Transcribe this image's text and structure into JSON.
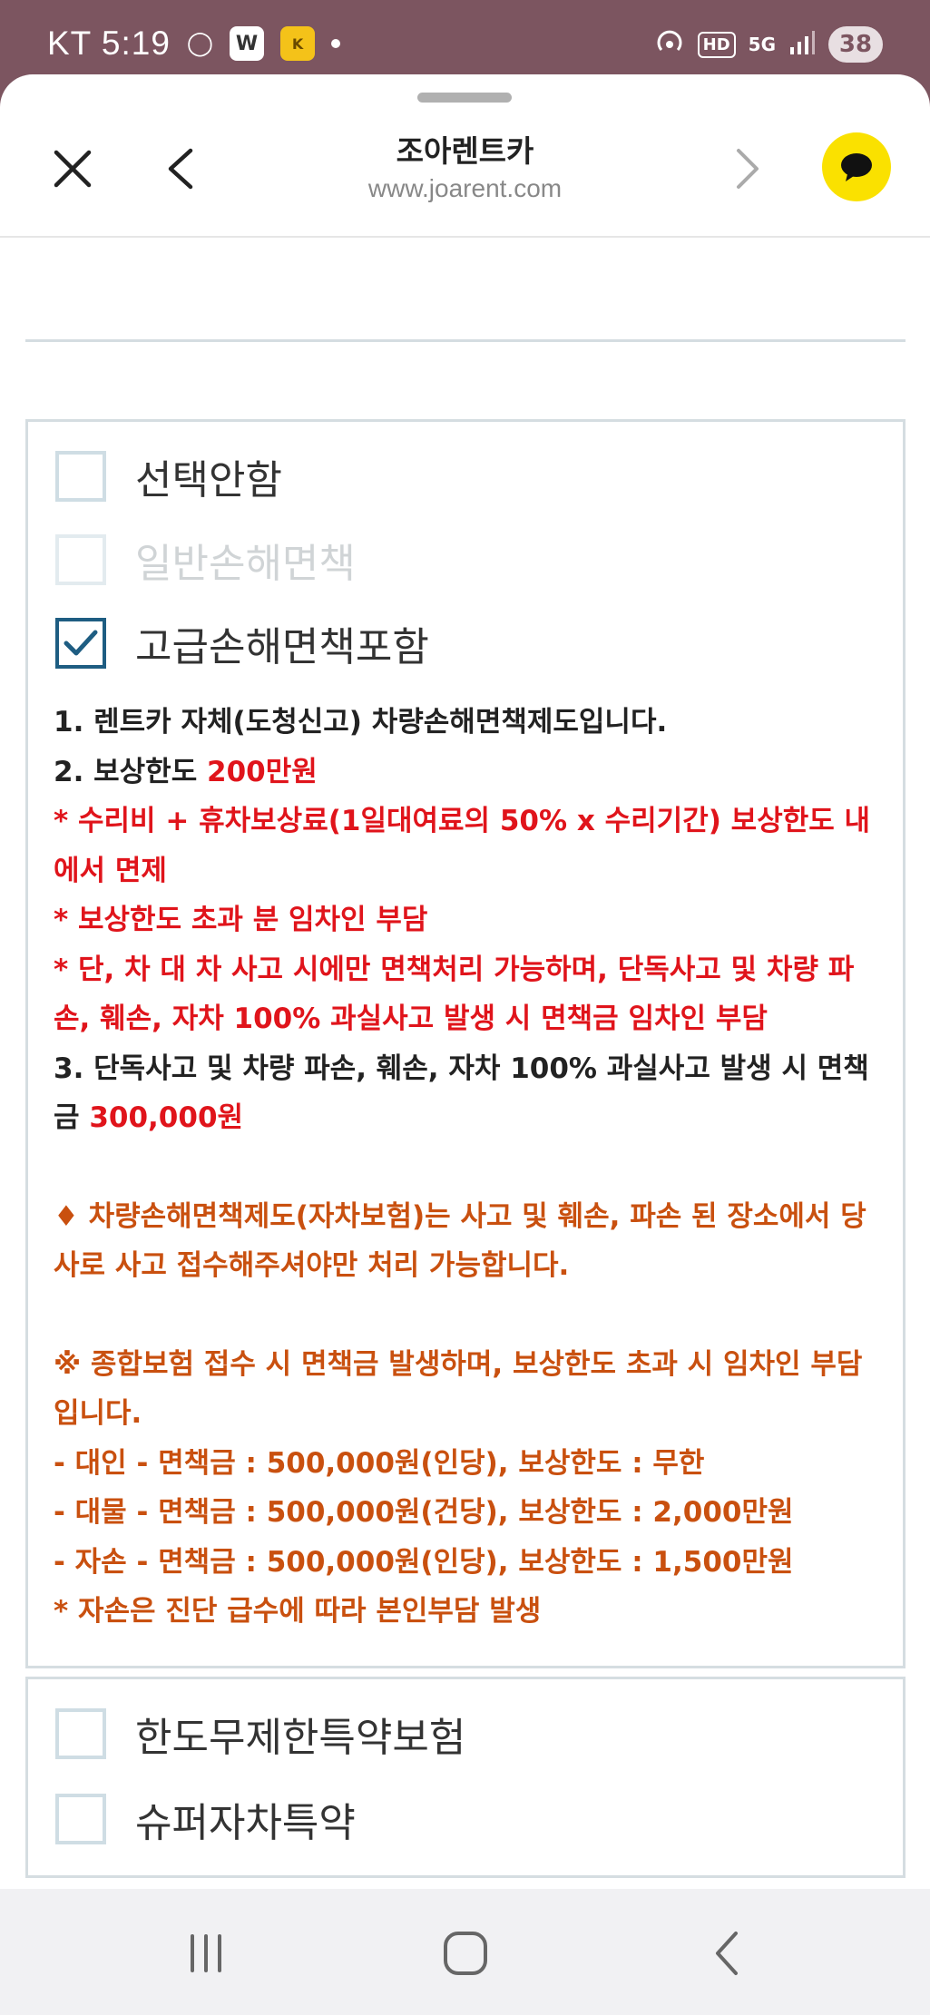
{
  "status_bar": {
    "carrier_time": "KT 5:19",
    "battery": "38",
    "network": "5G",
    "hd": "HD"
  },
  "header": {
    "title": "조아렌트카",
    "url": "www.joarent.com"
  },
  "options_group1": [
    {
      "label": "선택안함",
      "checked": false,
      "disabled": false
    },
    {
      "label": "일반손해면책",
      "checked": false,
      "disabled": true
    },
    {
      "label": "고급손해면책포함",
      "checked": true,
      "disabled": false
    }
  ],
  "description": {
    "l1": "1. 렌트카 자체(도청신고) 차량손해면책제도입니다.",
    "l2a": "2. 보상한도 ",
    "l2b": "200만원",
    "l3": " * 수리비 + 휴차보상료(1일대여료의 50% x 수리기간) 보상한도 내에서 면제",
    "l4": " * 보상한도 초과 분 임차인 부담",
    "l5": " * 단, 차 대 차 사고 시에만 면책처리 가능하며, 단독사고 및 차량 파손, 훼손, 자차 100% 과실사고  발생 시 면책금 임차인 부담",
    "l6a": "3. 단독사고 및 차량 파손, 훼손, 자차 100% 과실사고 발생 시 면책금 ",
    "l6b": "300,000원",
    "l7": "♦ 차량손해면책제도(자차보험)는 사고 및 훼손, 파손 된 장소에서 당사로 사고 접수해주셔야만 처리 가능합니다.",
    "l8": " ※ 종합보험 접수 시 면책금 발생하며, 보상한도 초과 시 임차인 부담 입니다.",
    "l9": " - 대인 - 면책금 : 500,000원(인당), 보상한도 : 무한",
    "l10": " - 대물 - 면책금 : 500,000원(건당), 보상한도 : 2,000만원",
    "l11": " - 자손 - 면책금 : 500,000원(인당), 보상한도 : 1,500만원",
    "l12": " * 자손은 진단 급수에 따라 본인부담 발생"
  },
  "options_group2": [
    {
      "label": "한도무제한특약보험",
      "checked": false
    },
    {
      "label": "슈퍼자차특약",
      "checked": false
    }
  ],
  "colors": {
    "status_bg": "#7c5560",
    "checkbox_checked": "#1e5d82",
    "red_text": "#e0141b",
    "orange_text": "#c9500f",
    "kakao_yellow": "#fae100"
  }
}
